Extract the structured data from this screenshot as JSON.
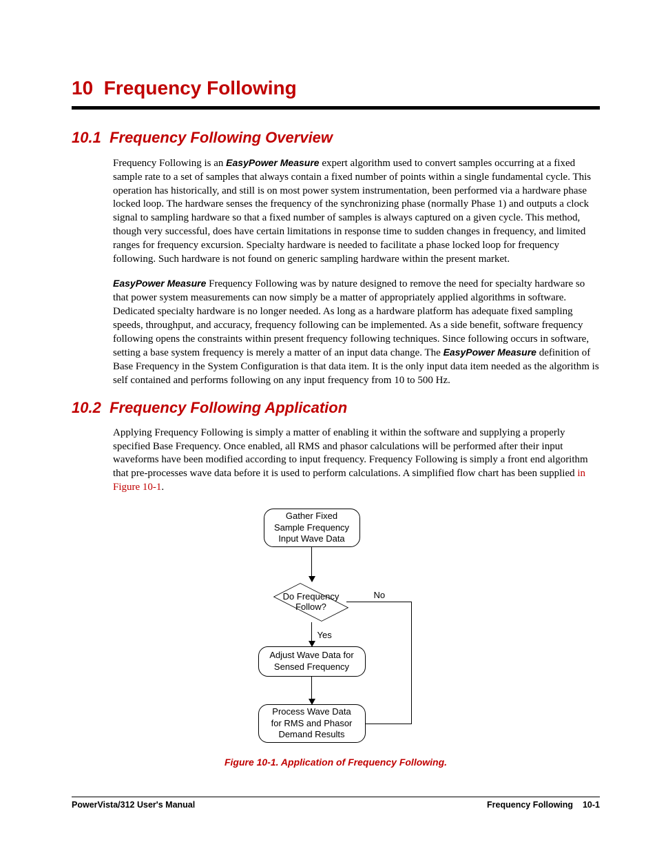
{
  "chapter": {
    "number": "10",
    "title": "Frequency Following"
  },
  "sections": {
    "s1": {
      "number": "10.1",
      "title": "Frequency Following Overview"
    },
    "s2": {
      "number": "10.2",
      "title": "Frequency Following Application"
    }
  },
  "paragraphs": {
    "p1a": "Frequency Following is an ",
    "p1_em1": "EasyPower Measure",
    "p1b": " expert algorithm used to convert samples occurring at a fixed sample rate to a set of samples that always contain a fixed number of points within a single fundamental cycle. This operation has historically, and still is on most power system  instrumentation, been performed via a hardware phase locked loop.  The hardware senses the frequency of the synchronizing phase (normally Phase 1) and outputs a clock signal to sampling hardware so that a fixed number of samples is always captured on a given cycle.  This method, though very successful, does have certain limitations in response time to sudden changes in frequency, and limited ranges for frequency excursion.  Specialty hardware is needed to facilitate a phase locked loop for frequency following.  Such hardware is not found on generic sampling hardware within the present market.",
    "p2_em1": "EasyPower Measure",
    "p2a": " Frequency Following was by nature designed to remove the need for specialty hardware so that power system measurements can now simply be a matter of appropriately applied algorithms in software.  Dedicated specialty hardware is no longer needed.  As long as a hardware platform has adequate fixed sampling speeds, throughput, and accuracy, frequency following can be implemented.  As a side benefit, software frequency following opens the constraints within present frequency following techniques.  Since following occurs in software, setting a base system frequency is merely a matter of an input data change.  The ",
    "p2_em2": "EasyPower Measure",
    "p2b": " definition of Base Frequency in the System Configuration is that data item.  It is the only input data item needed as the algorithm is self contained and performs following on any input frequency from 10 to 500 Hz.",
    "p3a": "Applying Frequency Following is simply a matter of enabling it within the software and supplying a properly specified Base Frequency.  Once enabled, all RMS and phasor calculations will be performed after their input waveforms have been modified according to input frequency.  Frequency Following is simply a front end algorithm that pre-processes wave data before it is used to perform calculations.  A simplified flow chart has been supplied ",
    "p3_xref": "in Figure 10-1",
    "p3b": "."
  },
  "flowchart": {
    "box1": "Gather Fixed\nSample Frequency\nInput Wave Data",
    "decision": "Do Frequency\nFollow?",
    "no": "No",
    "yes": "Yes",
    "box2": "Adjust Wave Data for\nSensed Frequency",
    "box3": "Process Wave Data\nfor RMS and Phasor\nDemand Results"
  },
  "figure_caption": "Figure 10-1.  Application of Frequency Following.",
  "footer": {
    "left": "PowerVista/312 User's Manual",
    "right_label": "Frequency Following",
    "right_page": "10-1"
  }
}
